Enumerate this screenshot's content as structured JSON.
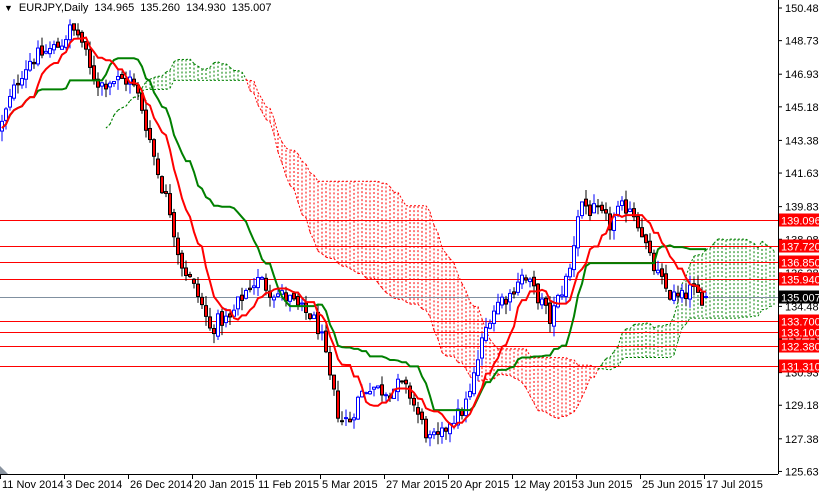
{
  "header": {
    "menu_icon": "triangle-down-icon",
    "symbol": "EURJPY,Daily",
    "open": "134.965",
    "high": "135.260",
    "low": "134.930",
    "close": "135.007"
  },
  "colors": {
    "background": "#ffffff",
    "bull_wick": "#0000ff",
    "bull_body": "#ffffff",
    "bear_wick": "#000000",
    "bear_body": "#ff0000",
    "tenkan": "#ff0000",
    "kijun": "#008000",
    "cloud_bull": "#008000",
    "cloud_bear": "#ff0000",
    "level_line": "#ff0000",
    "current_price_line": "#8090a0",
    "current_price_label": "#000000"
  },
  "chart_data": {
    "type": "candlestick",
    "symbol": "EURJPY",
    "timeframe": "Daily",
    "indicator": "Ichimoku Kinko Hyo (9,26,52)",
    "ylim": [
      125.63,
      150.48
    ],
    "y_ticks": [
      "150.480",
      "148.730",
      "146.930",
      "145.180",
      "143.380",
      "141.630",
      "139.830",
      "138.080",
      "136.280",
      "134.480",
      "132.730",
      "130.930",
      "129.180",
      "127.380",
      "125.630"
    ],
    "x_ticks": [
      "11 Nov 2014",
      "3 Dec 2014",
      "26 Dec 2014",
      "20 Jan 2015",
      "11 Feb 2015",
      "5 Mar 2015",
      "27 Mar 2015",
      "20 Apr 2015",
      "12 May 2015",
      "3 Jun 2015",
      "25 Jun 2015",
      "17 Jul 2015"
    ],
    "x_tick_bar_index": [
      0,
      16,
      32,
      48,
      64,
      80,
      96,
      112,
      128,
      144,
      160,
      176
    ],
    "bar_count": 177,
    "close_anchors_every_2_5_bars": [
      143.94,
      145.55,
      146.89,
      147.69,
      147.96,
      148.23,
      148.5,
      149.3,
      149.03,
      147.16,
      146.35,
      146.62,
      146.62,
      146.62,
      145.55,
      143.41,
      141.26,
      139.65,
      136.97,
      135.9,
      134.83,
      133.22,
      133.76,
      133.76,
      134.83,
      135.63,
      135.9,
      135.36,
      135.1,
      134.83,
      134.29,
      134.02,
      133.22,
      130.54,
      128.4,
      128.4,
      129.74,
      130.27,
      130.0,
      130.0,
      130.27,
      129.74,
      128.4,
      127.33,
      127.33,
      128.4,
      128.67,
      129.74,
      132.15,
      134.02,
      134.83,
      135.1,
      136.17,
      135.63,
      134.83,
      133.76,
      135.1,
      136.44,
      140.19,
      139.65,
      139.39,
      138.85,
      139.65,
      139.92,
      138.85,
      136.97,
      135.9,
      135.1,
      134.83,
      135.36,
      134.99
    ],
    "last_bar": {
      "open": 134.965,
      "high": 135.26,
      "low": 134.93,
      "close": 135.007
    },
    "levels": [
      "139.096",
      "137.720",
      "136.850",
      "135.940",
      "133.700",
      "133.100",
      "132.380",
      "131.310"
    ],
    "current_price": "135.007"
  }
}
